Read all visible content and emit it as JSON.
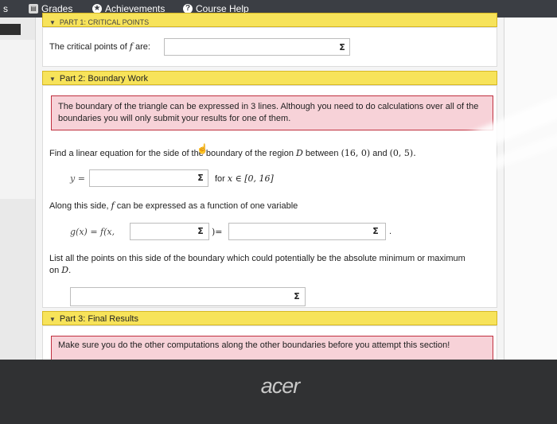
{
  "nav": {
    "edge_text": "s",
    "grades": "Grades",
    "achievements": "Achievements",
    "course_help": "Course Help"
  },
  "part1": {
    "title": "Part 1: Critical Points",
    "label_pre": "The critical points of ",
    "label_var": "f",
    "label_post": " are:",
    "answer": ""
  },
  "part2": {
    "title": "Part 2: Boundary Work",
    "notice": "The boundary of the triangle can be expressed in 3 lines. Although you need to do calculations over all of the boundaries you will only submit your results for one of them.",
    "q1_pre": "Find a linear equation for the side of the boundary of the region ",
    "q1_region": "D",
    "q1_mid": " between ",
    "q1_point1": "(16, 0)",
    "q1_and": " and ",
    "q1_point2": "(0, 5).",
    "y_label": "y =",
    "y_answer": "",
    "domain_pre": "for ",
    "domain_math": "x ∈ [0, 16]",
    "along_pre": "Along this side, ",
    "along_var": "f",
    "along_post": " can be expressed as a function of one variable",
    "g_label": "g(x) = f(x,",
    "g_paren": ")=",
    "g_inner_answer": "",
    "g_answer": "",
    "g_period": ".",
    "list_pre": "List all the points on this side of the boundary which could potentially be the absolute minimum or maximum",
    "list_on": "on ",
    "list_region": "D",
    "list_period": ".",
    "points_answer": ""
  },
  "part3": {
    "title": "Part 3: Final Results",
    "notice": "Make sure you do the other computations along the other boundaries before you attempt this section!"
  },
  "sigma": "Σ",
  "bezel_logo": "acer"
}
